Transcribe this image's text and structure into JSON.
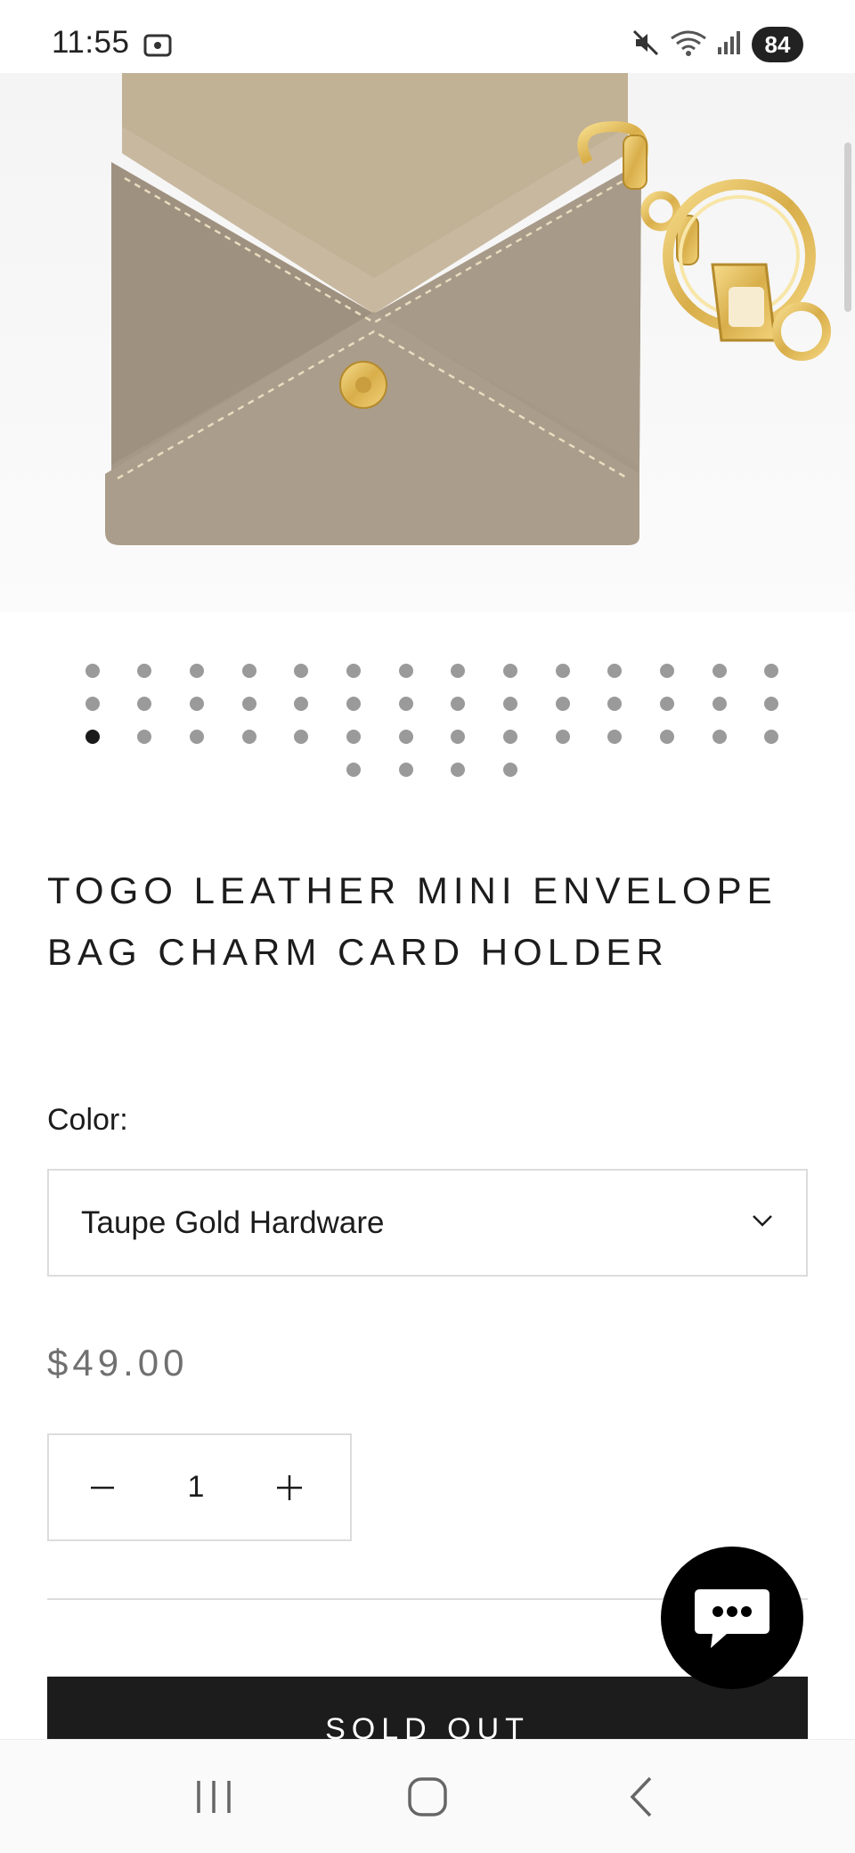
{
  "status_bar": {
    "time": "11:55",
    "battery": "84",
    "icons": [
      "screenshot-icon",
      "mute-icon",
      "wifi-icon",
      "signal-icon"
    ]
  },
  "product": {
    "image_alt": "Taupe leather envelope card holder with gold bag charm ring",
    "image_count": 46,
    "active_image_index": 28,
    "title": "TOGO LEATHER MINI ENVELOPE BAG CHARM CARD HOLDER",
    "color_label": "Color:",
    "color_selected": "Taupe Gold Hardware",
    "price": "$49.00",
    "quantity": "1",
    "button_label": "SOLD OUT"
  },
  "colors": {
    "leather": "#a69886",
    "gold": "#e6c56a",
    "button": "#1c1c1c",
    "price": "#707070"
  },
  "nav": {
    "icons": [
      "recents-icon",
      "home-icon",
      "back-icon"
    ]
  }
}
